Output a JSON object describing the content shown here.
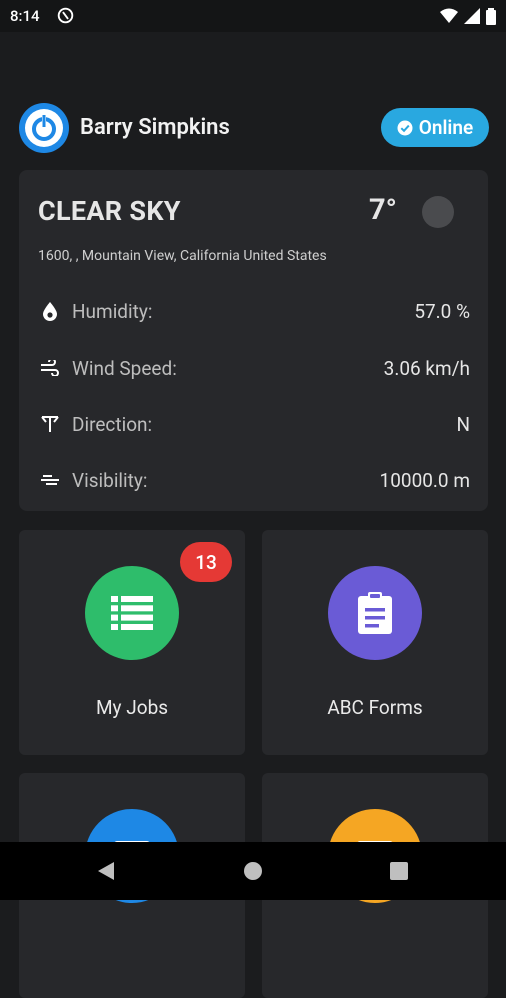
{
  "status_bar": {
    "time": "8:14"
  },
  "header": {
    "user_name": "Barry Simpkins",
    "status_label": "Online"
  },
  "weather": {
    "condition": "CLEAR SKY",
    "temperature": "7°",
    "location": "1600, , Mountain View, California United States",
    "rows": [
      {
        "icon": "humidity-icon",
        "label": "Humidity:",
        "value": "57.0 %"
      },
      {
        "icon": "wind-icon",
        "label": "Wind Speed:",
        "value": "3.06 km/h"
      },
      {
        "icon": "direction-icon",
        "label": "Direction:",
        "value": "N"
      },
      {
        "icon": "visibility-icon",
        "label": "Visibility:",
        "value": "10000.0 m"
      }
    ]
  },
  "tiles": [
    {
      "label": "My Jobs",
      "badge": "13",
      "color": "#2ebd6b",
      "icon": "list-icon"
    },
    {
      "label": "ABC Forms",
      "color": "#6a5bd6",
      "icon": "clipboard-icon"
    },
    {
      "label": "",
      "color": "#1e88e5",
      "icon": "doc-icon"
    },
    {
      "label": "",
      "color": "#f5a623",
      "icon": "doc-icon"
    }
  ],
  "colors": {
    "background": "#1b1c1e",
    "card": "#27282b",
    "online": "#29a8e0",
    "badge": "#e53935"
  }
}
